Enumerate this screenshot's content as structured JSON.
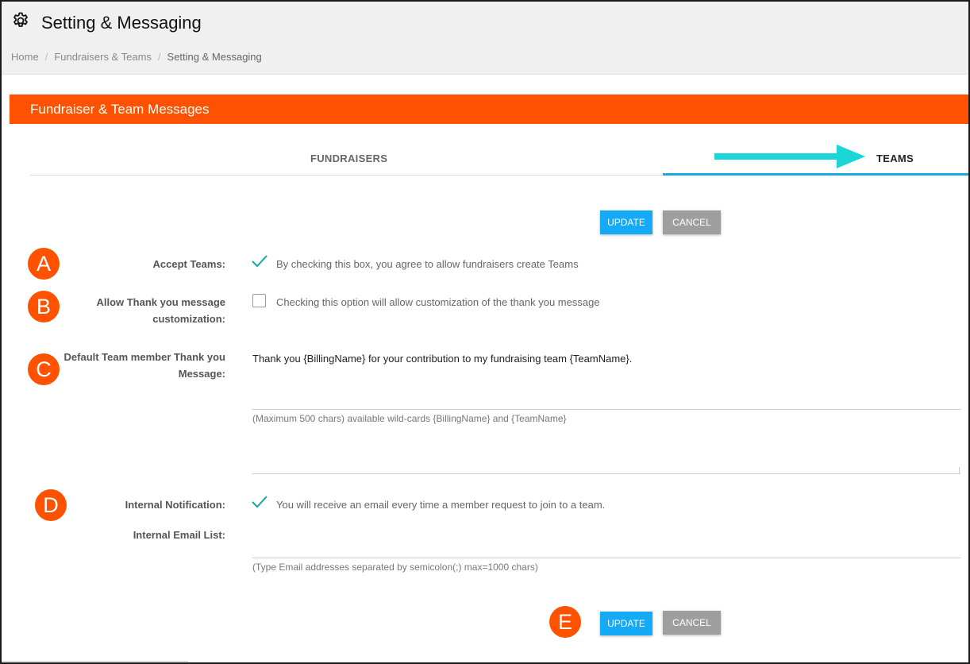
{
  "page": {
    "title": "Setting & Messaging",
    "breadcrumb": [
      "Home",
      "Fundraisers & Teams",
      "Setting & Messaging"
    ],
    "separator": "/"
  },
  "card": {
    "title": "Fundraiser & Team Messages"
  },
  "tabs": {
    "fundraisers": "FUNDRAISERS",
    "teams": "TEAMS",
    "active": "TEAMS"
  },
  "buttons": {
    "update": "UPDATE",
    "cancel": "CANCEL"
  },
  "form": {
    "accept_teams": {
      "label": "Accept Teams:",
      "checked": true,
      "description": "By checking this box, you agree to allow fundraisers create Teams"
    },
    "allow_thank_you": {
      "label_line1": "Allow Thank you message",
      "label_line2": "customization:",
      "checked": false,
      "description": "Checking this option will allow customization of the thank you message"
    },
    "default_message": {
      "label_line1": "Default Team member Thank you",
      "label_line2": "Message:",
      "value": "Thank you {BillingName} for your contribution to my fundraising team {TeamName}.",
      "hint": "(Maximum 500 chars)  available wild-cards {BillingName} and {TeamName}"
    },
    "internal_notification": {
      "label": "Internal Notification:",
      "checked": true,
      "description": "You will receive an email every time a member request to join to a team."
    },
    "internal_email_list": {
      "label": "Internal Email List:",
      "value": "",
      "hint": "(Type Email addresses separated by semicolon(;) max=1000 chars)"
    }
  },
  "annotations": [
    "A",
    "B",
    "C",
    "D",
    "E"
  ],
  "colors": {
    "brand_orange": "#ff5200",
    "tab_active": "#1aa7e6",
    "update_button": "#14aaf5",
    "cancel_button": "#9e9e9e",
    "check_mark": "#17a5a5",
    "annotation_arrow": "#1bd6d6"
  },
  "icons": {
    "settings": "gear-icon",
    "checkmark": "check-icon",
    "pointer": "arrow-right-icon"
  }
}
